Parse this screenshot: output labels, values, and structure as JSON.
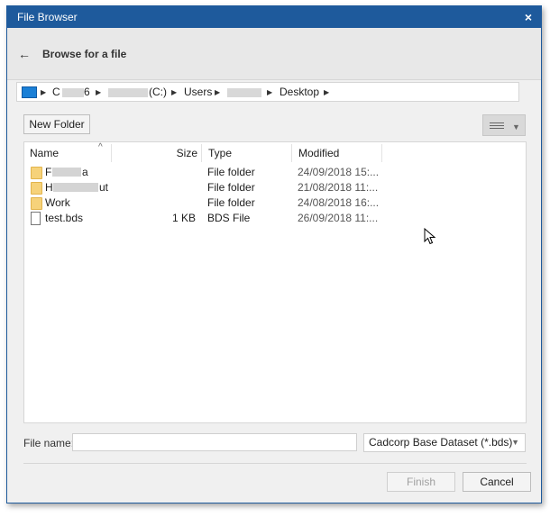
{
  "window": {
    "title": "File Browser",
    "close_glyph": "×"
  },
  "header": {
    "back_glyph": "←",
    "title": "Browse for a file"
  },
  "breadcrumb": {
    "items": [
      "C",
      "6",
      "(C:)",
      "Users",
      "Desktop"
    ],
    "icons": [
      "computer-icon",
      "triangle-right-icon"
    ]
  },
  "toolbar": {
    "new_folder_label": "New Folder",
    "view_icon": "details-view-icon"
  },
  "filelist": {
    "columns": {
      "name": "Name",
      "size": "Size",
      "type": "Type",
      "modified": "Modified"
    },
    "sort_indicator": "^",
    "rows": [
      {
        "name_prefix": "F",
        "name_suffix": "a",
        "size": "",
        "type": "File folder",
        "modified": "24/09/2018 15:...",
        "icon": "folder-icon"
      },
      {
        "name_prefix": "H",
        "name_suffix": "ut",
        "size": "",
        "type": "File folder",
        "modified": "21/08/2018 11:...",
        "icon": "folder-icon"
      },
      {
        "name_prefix": "Work",
        "name_suffix": "",
        "size": "",
        "type": "File folder",
        "modified": "24/08/2018 16:...",
        "icon": "folder-icon"
      },
      {
        "name_prefix": "test.bds",
        "name_suffix": "",
        "size": "1 KB",
        "type": "BDS File",
        "modified": "26/09/2018 11:...",
        "icon": "file-icon"
      }
    ]
  },
  "footer": {
    "filename_label": "File name:",
    "filename_value": "",
    "filter_value": "Cadcorp Base Dataset (*.bds)",
    "finish_label": "Finish",
    "cancel_label": "Cancel"
  },
  "colors": {
    "titlebar": "#1e5a9c",
    "folder": "#f6d27a",
    "dialog_bg": "#f0f0f0"
  }
}
